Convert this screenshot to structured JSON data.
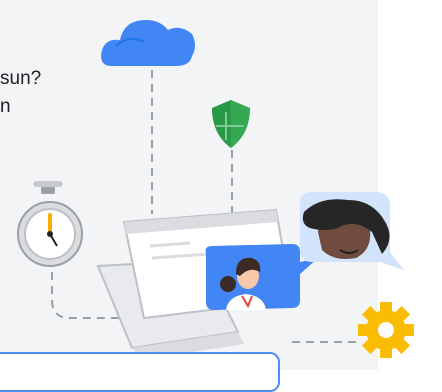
{
  "prompt": {
    "line1": "sun?",
    "line2": "n"
  },
  "colors": {
    "panel_bg": "#f3f4f6",
    "cloud": "#4285f4",
    "shield": "#34a853",
    "gear": "#fbbc04",
    "chat_bubble_blue": "#4285f4",
    "chat_bubble_light": "#d2e3fc",
    "dashed_line": "#9aa0a6",
    "input_border": "#4c8df6"
  },
  "icons": [
    "cloud-icon",
    "shield-icon",
    "stopwatch-icon",
    "laptop-icon",
    "gear-icon",
    "person-avatar-icon",
    "person-avatar-icon-2"
  ]
}
